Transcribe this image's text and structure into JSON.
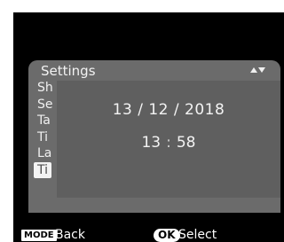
{
  "menu": {
    "title": "Settings",
    "scroll_icon": "scroll-up-down-icon",
    "items": [
      {
        "label": "Sh"
      },
      {
        "label": "Se"
      },
      {
        "label": "Ta"
      },
      {
        "label": "Ti"
      },
      {
        "label": "La"
      },
      {
        "label": "Ti"
      }
    ],
    "selected_index": 5
  },
  "dialog": {
    "date": "13 / 12 / 2018",
    "time_hours": "13",
    "time_separator": ":",
    "time_minutes": "58"
  },
  "footer": {
    "mode_label": "MODE",
    "back_label": "Back",
    "ok_label": "OK",
    "select_label": "Select"
  },
  "colors": {
    "lcd_background": "#000000",
    "panel": "#6b6b6b",
    "dialog": "#5f5f5f",
    "text": "#f3f3f3",
    "highlight": "#f3f3f3"
  }
}
